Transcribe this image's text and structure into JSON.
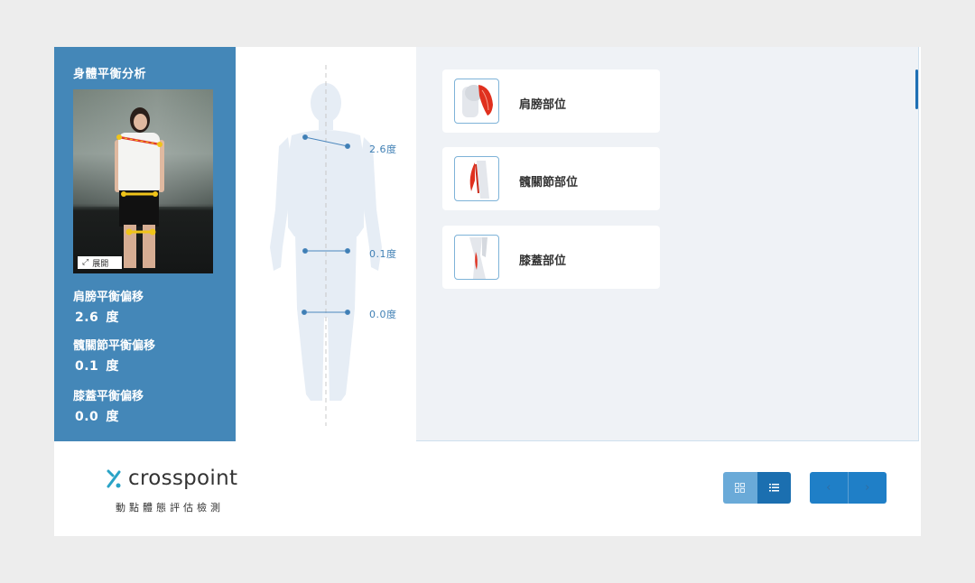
{
  "left_panel": {
    "title": "身體平衡分析",
    "expand_label": "展開",
    "metrics": [
      {
        "label": "肩膀平衡偏移",
        "value": "2.6",
        "unit": "度"
      },
      {
        "label": "髖關節平衡偏移",
        "value": "0.1",
        "unit": "度"
      },
      {
        "label": "膝蓋平衡偏移",
        "value": "0.0",
        "unit": "度"
      }
    ]
  },
  "diagram": {
    "labels": [
      "2.6度",
      "0.1度",
      "0.0度"
    ]
  },
  "cards": [
    {
      "label": "肩膀部位",
      "icon": "shoulder-muscle-icon"
    },
    {
      "label": "髖關節部位",
      "icon": "hip-muscle-icon"
    },
    {
      "label": "膝蓋部位",
      "icon": "knee-muscle-icon"
    }
  ],
  "footer": {
    "logo_text": "crosspoint",
    "logo_sub": "動點體態評估檢測",
    "icons": {
      "grid": "grid-view-icon",
      "list": "list-view-icon",
      "prev": "chevron-left-icon",
      "next": "chevron-right-icon"
    }
  },
  "colors": {
    "panel_blue": "#4487b8",
    "accent_blue": "#1f7fc7",
    "line_blue": "#3f7fb4",
    "muscle_red": "#e0301e"
  }
}
